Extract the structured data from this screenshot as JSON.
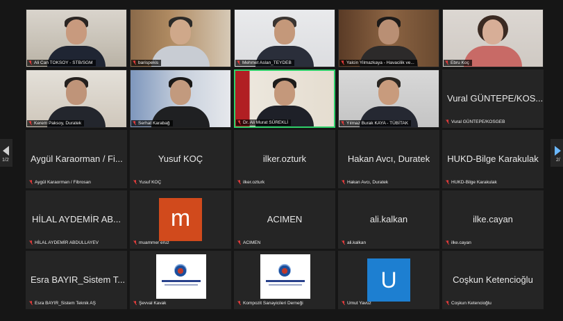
{
  "pager": {
    "prev_label": "1/2",
    "next_label": "2/"
  },
  "video_tiles": [
    {
      "display": "Ali Can TOKSOY - STB/SGM",
      "muted": true
    },
    {
      "display": "barispekis",
      "muted": true
    },
    {
      "display": "Mehmet Aslan_TEYDEB",
      "muted": true
    },
    {
      "display": "Yalcin Yilmazkaya - Havacilik ve...",
      "muted": true
    },
    {
      "display": "Ebru Koç",
      "muted": true
    },
    {
      "display": "Kerem Paksoy, Duratek",
      "muted": true
    },
    {
      "display": "Serhat Karabağ",
      "muted": true
    },
    {
      "display": "Dr. Ali Murat SÜREKLİ",
      "muted": true,
      "active": true
    },
    {
      "display": "Yılmaz Burak KAYA - TÜBİTAK",
      "muted": true
    }
  ],
  "name_tiles": [
    {
      "name": "Vural GÜNTEPE/KOS...",
      "display": "Vural GÜNTEPE/KOSGEB"
    },
    {
      "name": "Aygül Karaorman / Fi...",
      "display": "Aygül Karaorman / Fibrosan"
    },
    {
      "name": "Yusuf KOÇ",
      "display": "Yusuf KOÇ"
    },
    {
      "name": "ilker.ozturk",
      "display": "ilker.ozturk"
    },
    {
      "name": "Hakan Avcı, Duratek",
      "display": "Hakan Avcı, Duratek"
    },
    {
      "name": "HUKD-Bilge Karakulak",
      "display": "HUKD-Bilge Karakulak"
    },
    {
      "name": "HİLAL AYDEMİR AB...",
      "display": "HİLAL AYDEMİR ABDULLAYEV"
    },
    {
      "name": "ACIMEN",
      "display": "ACIMEN"
    },
    {
      "name": "ali.kalkan",
      "display": "ali.kalkan"
    },
    {
      "name": "ilke.cayan",
      "display": "ilke.cayan"
    },
    {
      "name": "Esra BAYIR_Sistem T...",
      "display": "Esra BAYIR_Sistem Teknik AŞ"
    },
    {
      "name": "Coşkun Ketencioğlu",
      "display": "Coşkun Ketencioğlu"
    }
  ],
  "avatar_tiles": [
    {
      "initial": "m",
      "display": "muammer eruz",
      "color": "#d14a1c"
    },
    {
      "initial": "U",
      "display": "Umut Yavuz",
      "color": "#1d7fd1"
    }
  ],
  "logo_tiles": [
    {
      "display": "Şevval Kavak"
    },
    {
      "display": "Kompozit Sanayicileri Derneği"
    }
  ]
}
